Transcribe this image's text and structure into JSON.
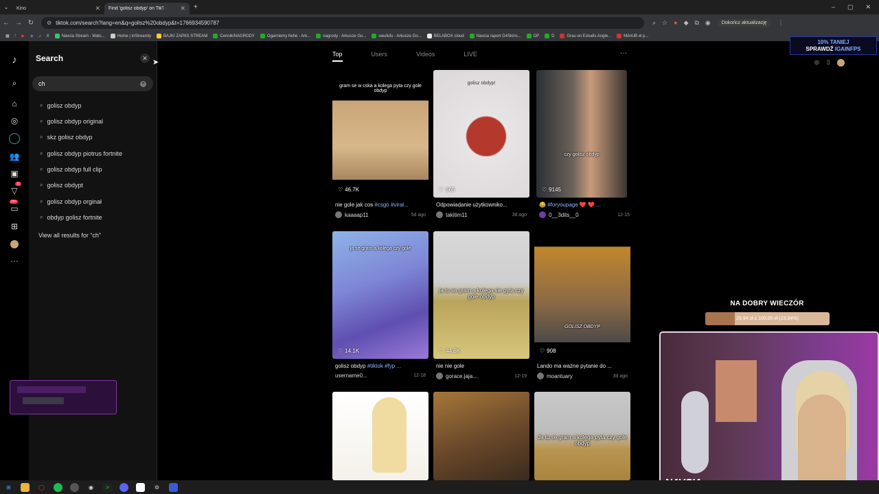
{
  "browser": {
    "tabs": [
      {
        "title": "Kino",
        "active": false
      },
      {
        "title": "Find 'golisz obdyp' on TikTok",
        "active": true
      }
    ],
    "url": "tiktok.com/search?lang=en&q=golisz%20obdyp&t=1766934590787",
    "update_label": "Dokończ aktualizację",
    "bookmarks": [
      "Navcia Stream - Watc...",
      "Home | inStreamly",
      "BAJKI ZAPAS STREAM",
      "Cennik/NAGRODY",
      "Ogarniemy hehe - Ark...",
      "nagrody - Arkusze Go...",
      "uwufufu - Arkusze Go...",
      "BELABOX cloud",
      "Navcia raport G4Skins...",
      "DP",
      "D",
      "Grau en Estudis Angle...",
      "MōnUB el p..."
    ]
  },
  "sidebar": {
    "badges": {
      "inbox": "11",
      "messages": "99+"
    }
  },
  "search": {
    "title": "Search",
    "input_value": "ch",
    "suggestions": [
      "golisz obdyp",
      "golisz obdyp original",
      "skz golisz obdyp",
      "golisz obdyp piotrus fortnite",
      "golisz obdyp full clip",
      "golisz obdypt",
      "golisz obdyp orginał",
      "obdyp golisz fortnite"
    ],
    "view_all": "View all results for “ch”"
  },
  "results": {
    "tabs": [
      "Top",
      "Users",
      "Videos",
      "LIVE"
    ],
    "active_tab": "Top",
    "videos": [
      {
        "caption": "gram se w cska a kolega pyta czy gole obdyp",
        "likes": "46.7K",
        "desc_plain": "nie gole jak cos ",
        "desc_tags": "#csgo #viral...",
        "user": "kaaaap11",
        "date": "5d ago"
      },
      {
        "caption": "golisz obdyp!",
        "likes": "665",
        "desc_plain": "Odpowiadanie użytkowniko...",
        "desc_tags": "",
        "user": "takitim11",
        "date": "3d ago"
      },
      {
        "caption": "czy golisz obdyp",
        "likes": "9145",
        "desc_plain": "😂 ",
        "desc_tags": "#foryoupage ❤️ ❤️ ...",
        "user": "0__3dits__0",
        "date": "12-15"
      },
      {
        "caption": "ja se gram a kolega czy gole",
        "likes": "14.1K",
        "desc_plain": "golisz obdyp ",
        "desc_tags": "#tiktok #fyp ...",
        "user": "username0...",
        "date": "12-18"
      },
      {
        "caption": "ja tu se gram a kolega sie pyta czy gole obdyp",
        "likes": "44.6K",
        "desc_plain": "nie nie gole",
        "desc_tags": "",
        "user": "gorace.jaja....",
        "date": "12-19"
      },
      {
        "caption": "GOLISZ OBDYP",
        "likes": "908",
        "desc_plain": "Lando ma ważne pytanie do ...",
        "desc_tags": "",
        "user": "moantuary",
        "date": "3d ago"
      },
      {
        "caption": "",
        "likes": "",
        "desc_plain": "",
        "desc_tags": "",
        "user": "",
        "date": ""
      },
      {
        "caption": "",
        "likes": "",
        "desc_plain": "",
        "desc_tags": "",
        "user": "",
        "date": ""
      },
      {
        "caption": "Ja tu se gram a kolega pyta czy gole obdyp",
        "likes": "",
        "desc_plain": "",
        "desc_tags": "",
        "user": "",
        "date": ""
      }
    ]
  },
  "overlay": {
    "ad_line1": "10% TANIEJ",
    "ad_line2_a": "SPRAWDŹ ",
    "ad_line2_b": "IGAINFPS",
    "goal_title": "NA DOBRY WIECZÓR",
    "goal_text": "23,94 zł z 100,00 zł (23.94%)",
    "goal_progress": 0.2394,
    "cam_brand": "NAVCIA"
  },
  "colors": {
    "accent_tag": "#8fb5ff",
    "goal_fill": "#a8744f"
  }
}
